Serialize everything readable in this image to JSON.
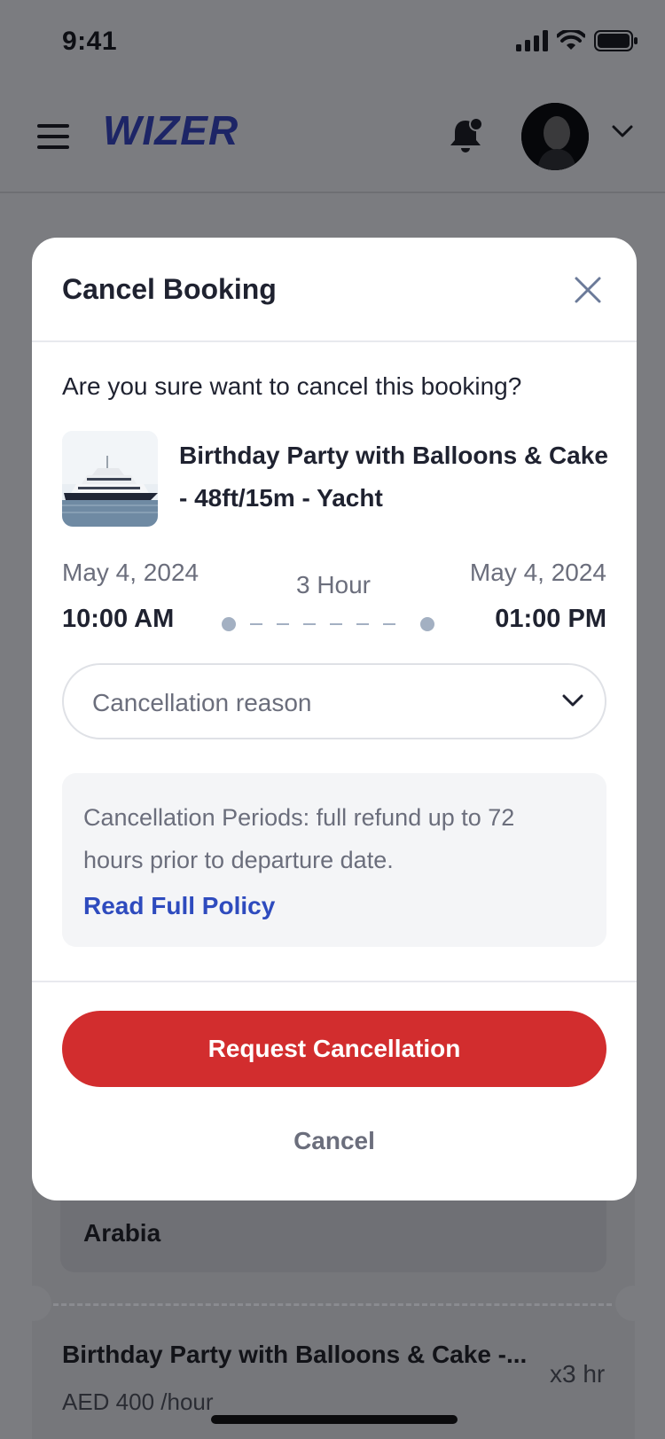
{
  "status_bar": {
    "time": "9:41"
  },
  "app_bar": {
    "logo_text": "WIZER",
    "icons": {
      "menu": "menu-icon",
      "notification": "bell-icon",
      "avatar": "avatar",
      "dropdown": "chevron-down-icon"
    }
  },
  "background": {
    "card_text_tail": "Arabia",
    "item": {
      "title": "Birthday Party with Balloons & Cake -...",
      "price": "AED 400 /hour",
      "quantity": "x3 hr"
    }
  },
  "modal": {
    "title": "Cancel Booking",
    "question": "Are you sure want to cancel this booking?",
    "booking": {
      "title": "Birthday Party with Balloons & Cake - 48ft/15m - Yacht"
    },
    "schedule": {
      "start_date": "May 4, 2024",
      "start_time": "10:00 AM",
      "duration": "3 Hour",
      "end_date": "May 4, 2024",
      "end_time": "01:00 PM"
    },
    "reason_select": {
      "placeholder": "Cancellation reason"
    },
    "policy": {
      "text": "Cancellation Periods: full refund up to 72 hours prior to departure date.",
      "link_label": "Read Full Policy"
    },
    "actions": {
      "request_label": "Request Cancellation",
      "cancel_label": "Cancel"
    }
  },
  "colors": {
    "brand": "#1d2566",
    "danger": "#d22d2e",
    "link": "#2e4bbe",
    "muted_text": "#6b6e7c",
    "overlay_bg": "#7b7c80"
  }
}
